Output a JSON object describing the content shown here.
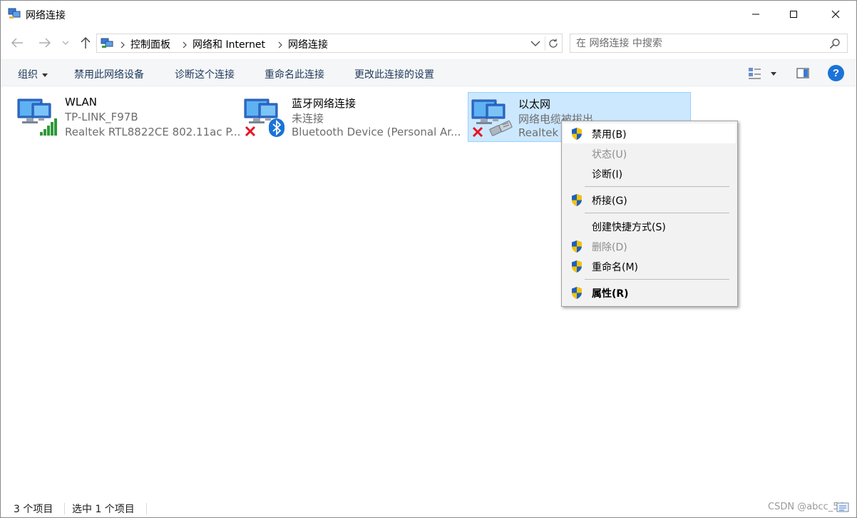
{
  "window": {
    "title": "网络连接"
  },
  "address": {
    "crumbs": [
      "控制面板",
      "网络和 Internet",
      "网络连接"
    ]
  },
  "search": {
    "placeholder": "在 网络连接 中搜索"
  },
  "commands": {
    "organize": "组织",
    "disable": "禁用此网络设备",
    "diagnose": "诊断这个连接",
    "rename": "重命名此连接",
    "change_settings": "更改此连接的设置"
  },
  "connections": [
    {
      "name": "WLAN",
      "status": "TP-LINK_F97B",
      "device": "Realtek RTL8822CE 802.11ac P...",
      "icon": "wifi-adapter-icon",
      "overlay": "signal-bars-icon"
    },
    {
      "name": "蓝牙网络连接",
      "status": "未连接",
      "device": "Bluetooth Device (Personal Ar...",
      "icon": "bluetooth-adapter-icon",
      "overlay": "disconnected-x-icon"
    },
    {
      "name": "以太网",
      "status": "网络电缆被拔出",
      "device": "Realtek",
      "icon": "ethernet-adapter-icon",
      "overlay": "disconnected-x-icon",
      "selected": true
    }
  ],
  "context_menu": {
    "items": [
      {
        "label": "禁用(B)",
        "shield": true,
        "disabled": false
      },
      {
        "label": "状态(U)",
        "shield": false,
        "disabled": true
      },
      {
        "label": "诊断(I)",
        "shield": false,
        "disabled": false
      },
      {
        "label": "桥接(G)",
        "shield": true,
        "disabled": false
      },
      {
        "label": "创建快捷方式(S)",
        "shield": false,
        "disabled": false
      },
      {
        "label": "删除(D)",
        "shield": true,
        "disabled": true
      },
      {
        "label": "重命名(M)",
        "shield": true,
        "disabled": false
      },
      {
        "label": "属性(R)",
        "shield": true,
        "disabled": false,
        "bold": true
      }
    ]
  },
  "statusbar": {
    "count": "3 个项目",
    "selected": "选中 1 个项目",
    "watermark": "CSDN @abcc_56"
  },
  "colors": {
    "selection_bg": "#cce8ff",
    "selection_border": "#99d1ff",
    "help_blue": "#1a73d8",
    "error_red": "#e81123",
    "shield_blue": "#1f5fbf",
    "shield_yellow": "#f2c400"
  }
}
